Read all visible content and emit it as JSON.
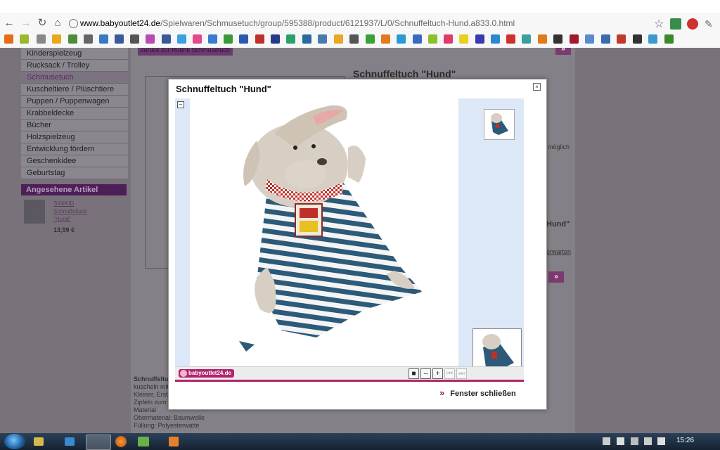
{
  "browser": {
    "url_host": "www.babyoutlet24.de",
    "url_path": "/Spielwaren/Schmusetuch/group/595388/product/6121937/L/0/Schnuffeltuch-Hund.a833.0.html"
  },
  "background": {
    "sidebar_items": [
      {
        "label": "Kinderspielzeug"
      },
      {
        "label": "Rucksack / Trolley"
      },
      {
        "label": "Schmusetuch"
      },
      {
        "label": "Kuscheltiere / Plüschtiere"
      },
      {
        "label": "Puppen / Puppenwagen"
      },
      {
        "label": "Krabbeldecke"
      },
      {
        "label": "Bücher"
      },
      {
        "label": "Holzspielzeug"
      },
      {
        "label": "Entwicklung fördern"
      },
      {
        "label": "Geschenkidee"
      },
      {
        "label": "Geburtstag"
      }
    ],
    "seen_heading": "Angesehene Artikel",
    "seen_item_brand": "SIGIKID",
    "seen_item_name": "Schnuffeltuch",
    "seen_item_name2": "\"Hund\"",
    "seen_item_price": "13,59 €",
    "back_link": "zurück zur Rubrik Schmusetuch",
    "product_title": "Schnuffeltuch \"Hund\"",
    "right_text_1": "möglich",
    "right_text_2": "Hund\"",
    "right_text_3": "erwarten",
    "desc_lines": [
      "Schnuffeltuch",
      "kuscheln mit",
      "Kleiner, Erst",
      "Zipfeln zum",
      "Material",
      "Obermaterial: Baumwolle",
      "Füllung: Polyesterwatte"
    ]
  },
  "modal": {
    "title": "Schnuffeltuch \"Hund\"",
    "close_label": "Fenster schließen",
    "logo_text": "babyoutlet24.de"
  },
  "taskbar": {
    "time": "15:26"
  }
}
